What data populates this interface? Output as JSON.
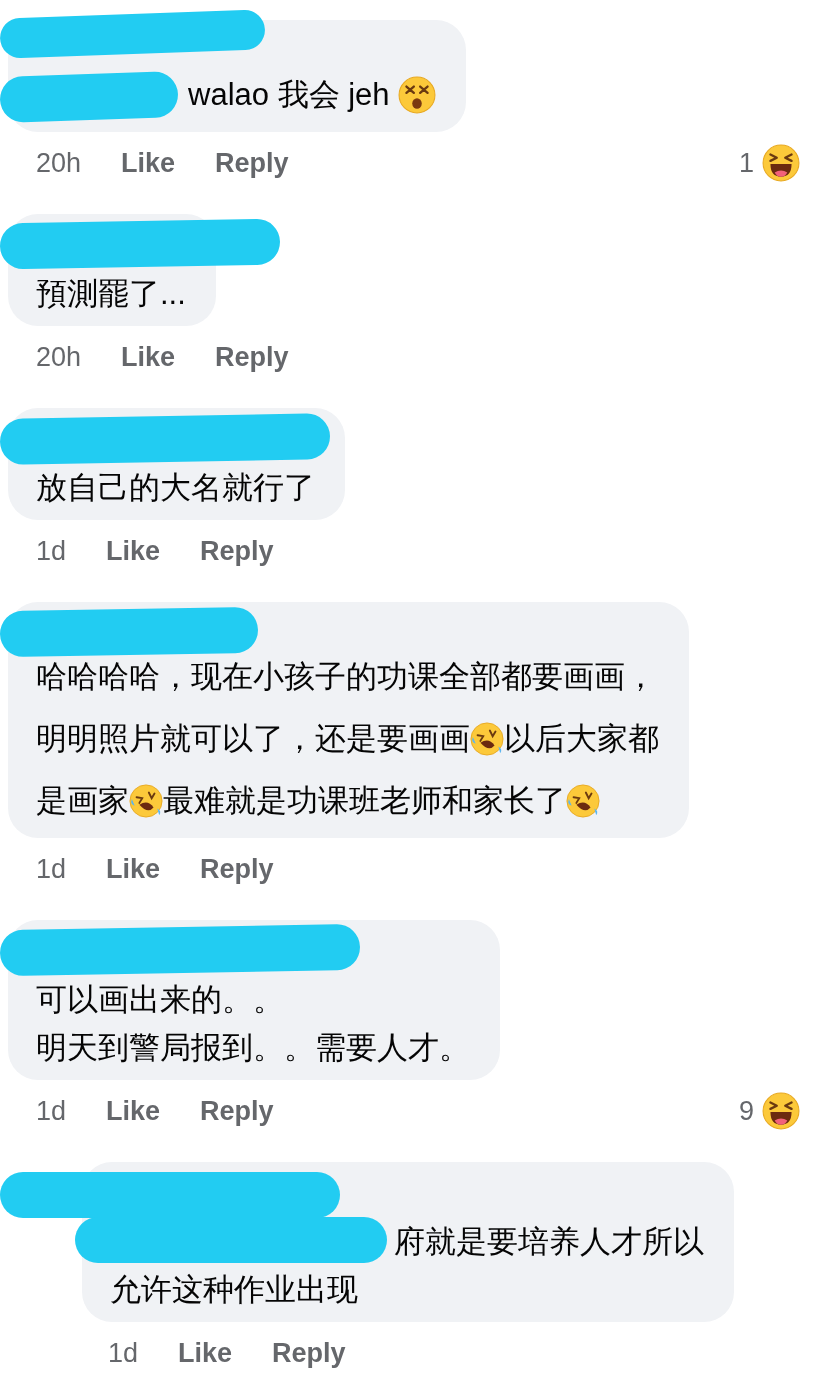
{
  "comments": [
    {
      "indented": false,
      "lines": [
        [
          {
            "kind": "text",
            "text": "walao 我会 jeh "
          },
          {
            "kind": "dizzy-emoji"
          }
        ]
      ],
      "time": "20h",
      "like": "Like",
      "reply": "Reply",
      "reaction": {
        "count": "1",
        "kind": "laugh"
      }
    },
    {
      "indented": false,
      "lines": [
        [
          {
            "kind": "text",
            "text": "預測罷了..."
          }
        ]
      ],
      "time": "20h",
      "like": "Like",
      "reply": "Reply"
    },
    {
      "indented": false,
      "lines": [
        [
          {
            "kind": "text",
            "text": "放自己的大名就行了"
          }
        ]
      ],
      "time": "1d",
      "like": "Like",
      "reply": "Reply"
    },
    {
      "indented": false,
      "lines": [
        [
          {
            "kind": "text",
            "text": "哈哈哈哈，现在小孩子的功课全部都要画画，"
          }
        ],
        [
          {
            "kind": "text",
            "text": "明明照片就可以了，还是要画画"
          },
          {
            "kind": "rofl-emoji"
          },
          {
            "kind": "text",
            "text": "以后大家都"
          }
        ],
        [
          {
            "kind": "text",
            "text": "是画家"
          },
          {
            "kind": "rofl-emoji"
          },
          {
            "kind": "text",
            "text": "最难就是功课班老师和家长了"
          },
          {
            "kind": "rofl-emoji"
          }
        ]
      ],
      "time": "1d",
      "like": "Like",
      "reply": "Reply"
    },
    {
      "indented": false,
      "lines": [
        [
          {
            "kind": "text",
            "text": "可以画出来的。。"
          }
        ],
        [
          {
            "kind": "text",
            "text": "明天到警局报到。。需要人才。"
          }
        ]
      ],
      "time": "1d",
      "like": "Like",
      "reply": "Reply",
      "reaction": {
        "count": "9",
        "kind": "laugh"
      }
    },
    {
      "indented": true,
      "lines": [
        [
          {
            "kind": "text",
            "text": "府就是要培养人才所以"
          }
        ],
        [
          {
            "kind": "text",
            "text": "允许这种作业出现"
          }
        ]
      ],
      "time": "1d",
      "like": "Like",
      "reply": "Reply"
    }
  ]
}
